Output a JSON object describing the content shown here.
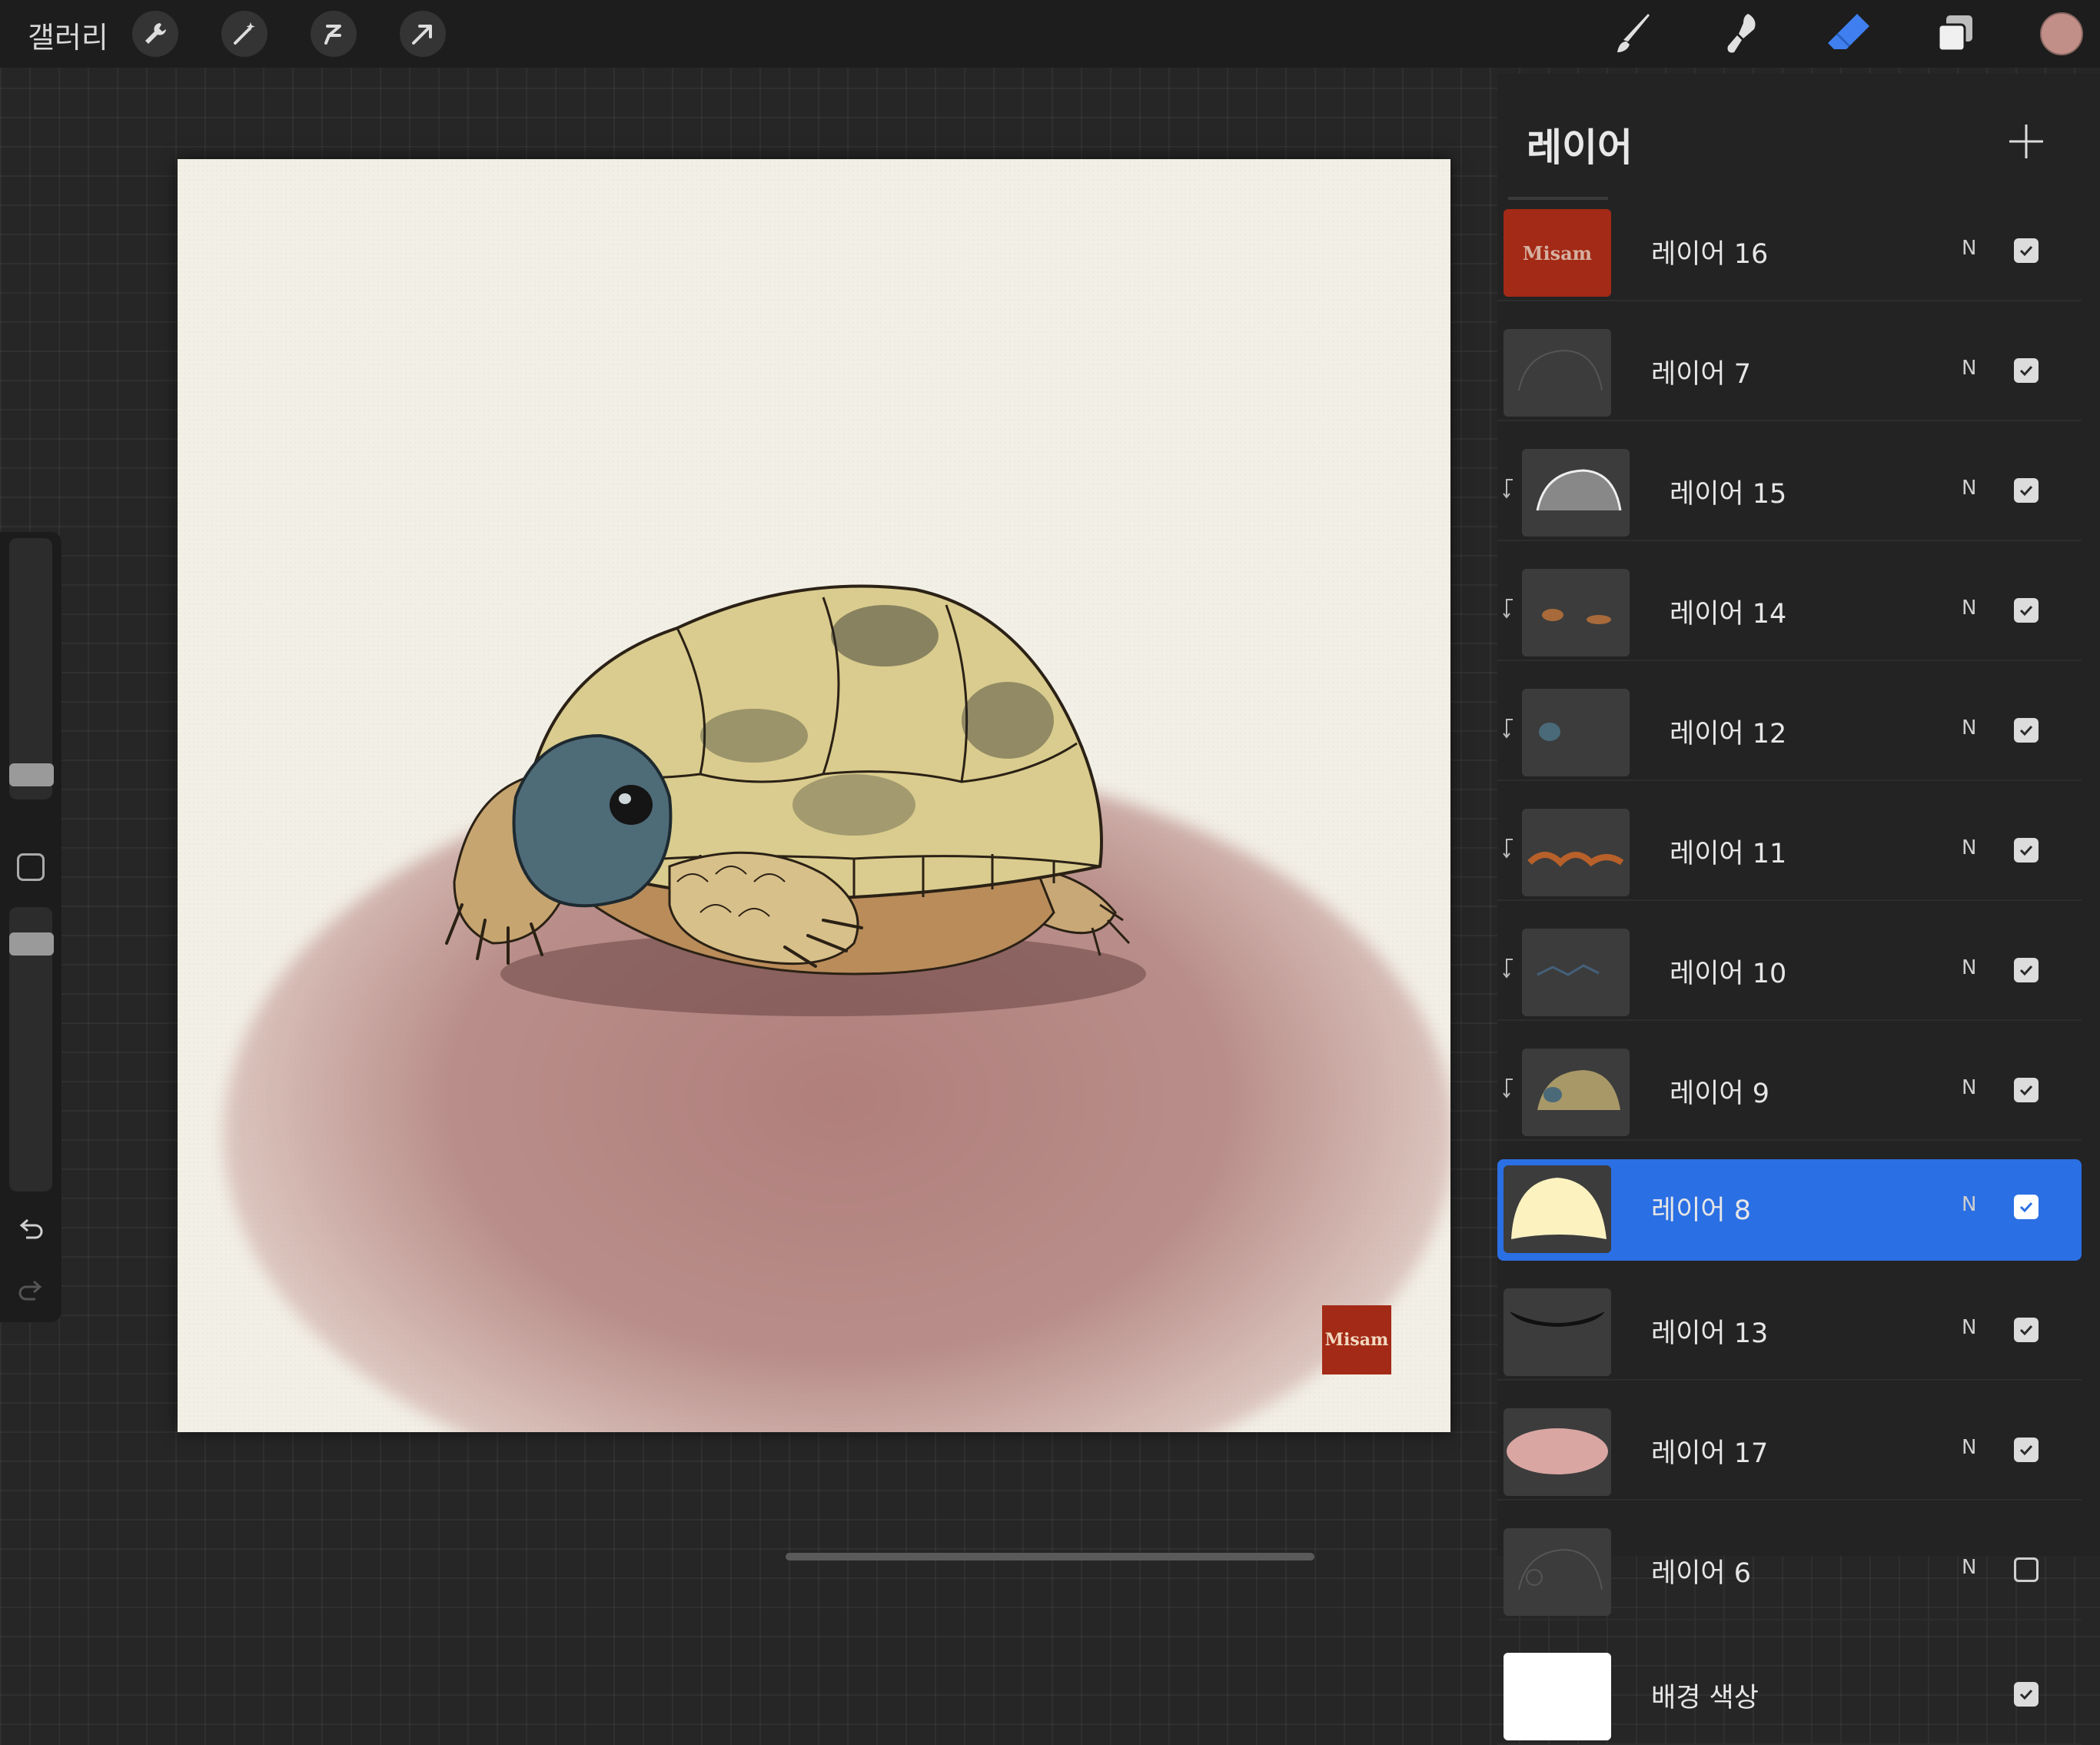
{
  "topbar": {
    "gallery_label": "갤러리",
    "left_tools": [
      "wrench-icon",
      "magic-wand-icon",
      "selection-icon",
      "transform-arrow-icon"
    ],
    "right_tools": [
      "brush-icon",
      "smudge-icon",
      "eraser-icon",
      "layers-icon"
    ],
    "active_tool": "eraser-icon",
    "current_color": "#c28f88"
  },
  "canvas": {
    "signature_text": "Misam",
    "signature_color": "#a32a16"
  },
  "layers_panel": {
    "title": "레이어",
    "layers": [
      {
        "name": "레이어 16",
        "blend": "N",
        "visible": true,
        "clipped": false,
        "selected": false
      },
      {
        "name": "레이어 7",
        "blend": "N",
        "visible": true,
        "clipped": false,
        "selected": false
      },
      {
        "name": "레이어 15",
        "blend": "N",
        "visible": true,
        "clipped": true,
        "selected": false
      },
      {
        "name": "레이어 14",
        "blend": "N",
        "visible": true,
        "clipped": true,
        "selected": false
      },
      {
        "name": "레이어 12",
        "blend": "N",
        "visible": true,
        "clipped": true,
        "selected": false
      },
      {
        "name": "레이어 11",
        "blend": "N",
        "visible": true,
        "clipped": true,
        "selected": false
      },
      {
        "name": "레이어 10",
        "blend": "N",
        "visible": true,
        "clipped": true,
        "selected": false
      },
      {
        "name": "레이어 9",
        "blend": "N",
        "visible": true,
        "clipped": true,
        "selected": false
      },
      {
        "name": "레이어 8",
        "blend": "N",
        "visible": true,
        "clipped": false,
        "selected": true
      },
      {
        "name": "레이어 13",
        "blend": "N",
        "visible": true,
        "clipped": false,
        "selected": false
      },
      {
        "name": "레이어 17",
        "blend": "N",
        "visible": true,
        "clipped": false,
        "selected": false
      },
      {
        "name": "레이어 6",
        "blend": "N",
        "visible": false,
        "clipped": false,
        "selected": false
      },
      {
        "name": "배경 색상",
        "blend": "",
        "visible": true,
        "clipped": false,
        "selected": false
      }
    ],
    "selected_color": "#2b6fe4"
  }
}
